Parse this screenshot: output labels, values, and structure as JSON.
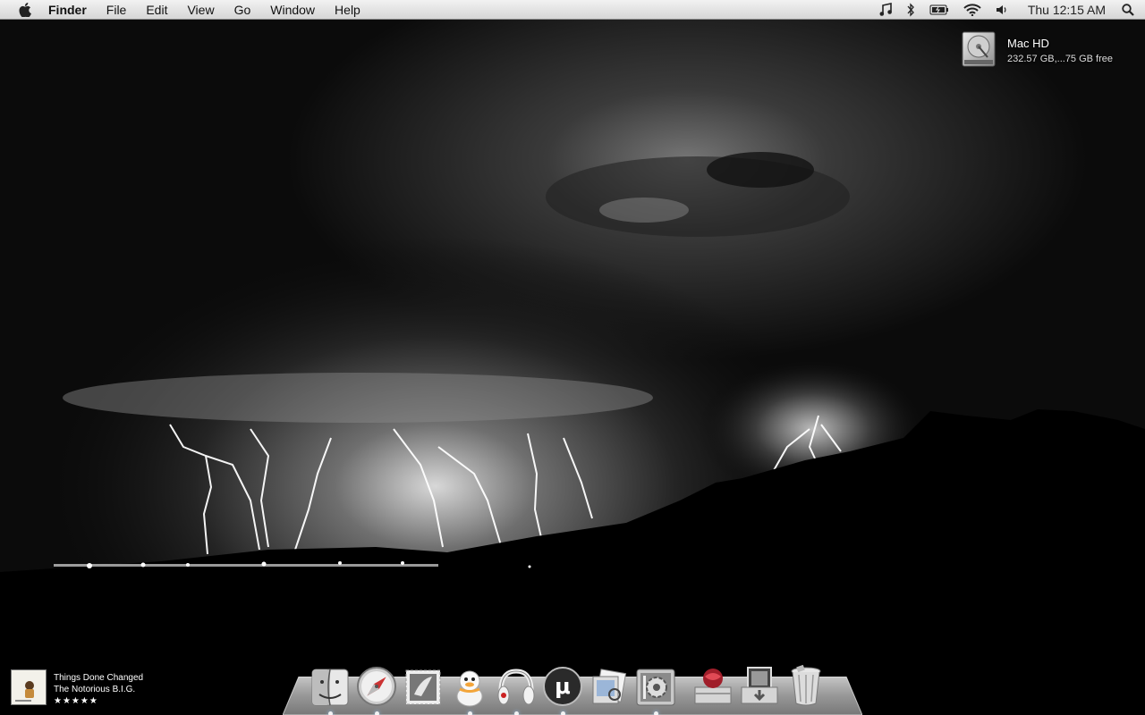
{
  "menubar": {
    "apple_icon": "apple-logo-icon",
    "app_name": "Finder",
    "menus": [
      "File",
      "Edit",
      "View",
      "Go",
      "Window",
      "Help"
    ],
    "status_icons": [
      "music-note-icon",
      "bluetooth-icon",
      "battery-icon",
      "wifi-icon",
      "volume-icon"
    ],
    "clock": "Thu 12:15 AM",
    "spotlight_icon": "magnifier-icon"
  },
  "desktop": {
    "wallpaper": "night lightning storm over mountains",
    "disk": {
      "name": "Mac HD",
      "info": "232.57 GB,...75 GB free"
    }
  },
  "now_playing": {
    "track": "Things Done Changed",
    "artist": "The Notorious B.I.G.",
    "rating": "★★★★★"
  },
  "dock": {
    "apps": [
      {
        "name": "Finder",
        "icon": "finder-icon",
        "running": true
      },
      {
        "name": "Safari",
        "icon": "safari-compass-icon",
        "running": true
      },
      {
        "name": "Mail",
        "icon": "mail-stamp-icon",
        "running": false
      },
      {
        "name": "Adium",
        "icon": "adium-duck-icon",
        "running": true
      },
      {
        "name": "Beats",
        "icon": "headphones-icon",
        "running": true
      },
      {
        "name": "uTorrent",
        "icon": "utorrent-icon",
        "running": true
      },
      {
        "name": "Preview",
        "icon": "preview-icon",
        "running": false
      },
      {
        "name": "System Preferences",
        "icon": "system-preferences-icon",
        "running": true
      }
    ],
    "stacks": [
      {
        "name": "Applications",
        "icon": "applications-stack-icon"
      },
      {
        "name": "Downloads",
        "icon": "downloads-stack-icon"
      },
      {
        "name": "Trash",
        "icon": "trash-icon"
      }
    ]
  }
}
